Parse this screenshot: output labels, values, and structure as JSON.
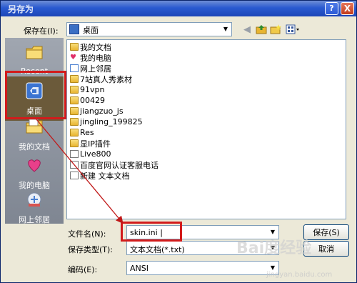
{
  "window": {
    "title": "另存为"
  },
  "titlebar_buttons": {
    "help": "?",
    "close": "X"
  },
  "save_in": {
    "label": "保存在(I):",
    "value": "桌面"
  },
  "places": [
    {
      "label": "Recent",
      "icon": "recent-folder-icon"
    },
    {
      "label": "桌面",
      "icon": "desktop-icon",
      "selected": true
    },
    {
      "label": "我的文档",
      "icon": "my-documents-icon"
    },
    {
      "label": "我的电脑",
      "icon": "my-computer-icon"
    },
    {
      "label": "网上邻居",
      "icon": "network-icon"
    }
  ],
  "files": [
    {
      "name": "我的文档",
      "icon": "folder"
    },
    {
      "name": "我的电脑",
      "icon": "computer"
    },
    {
      "name": "网上邻居",
      "icon": "network"
    },
    {
      "name": "7站真人秀素材",
      "icon": "folder"
    },
    {
      "name": "91vpn",
      "icon": "folder"
    },
    {
      "name": "00429",
      "icon": "folder"
    },
    {
      "name": "jiangzuo_js",
      "icon": "folder"
    },
    {
      "name": "jingling_199825",
      "icon": "folder"
    },
    {
      "name": "Res",
      "icon": "folder"
    },
    {
      "name": "显IP插件",
      "icon": "folder"
    },
    {
      "name": "Live800",
      "icon": "doc"
    },
    {
      "name": "百度官网认证客服电话",
      "icon": "doc"
    },
    {
      "name": "新建 文本文档",
      "icon": "doc"
    }
  ],
  "filename": {
    "label": "文件名(N):",
    "value": "skin.ini |"
  },
  "filetype": {
    "label": "保存类型(T):",
    "value": "文本文档(*.txt)"
  },
  "encoding": {
    "label": "编码(E):",
    "value": "ANSI"
  },
  "buttons": {
    "save": "保存(S)",
    "cancel": "取消"
  },
  "watermark": {
    "logo": "Bai度经验",
    "url": "jingyan.baidu.com"
  },
  "colors": {
    "highlight": "#d21b1b",
    "titlebar": "#2a5ad0",
    "places_bg": "#8a909b"
  }
}
